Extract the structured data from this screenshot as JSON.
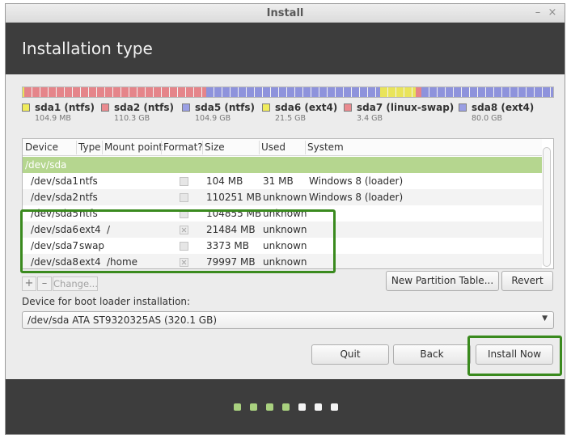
{
  "window": {
    "title": "Install",
    "minimize_glyph": "–",
    "close_glyph": "×"
  },
  "header": {
    "heading": "Installation type"
  },
  "partition_bar": {
    "segments": [
      {
        "name": "sda1",
        "share": 0.33,
        "color": "#e9e45a"
      },
      {
        "name": "sda2",
        "share": 34.46,
        "color": "#e5858a"
      },
      {
        "name": "sda5",
        "share": 32.77,
        "color": "#8e93dc"
      },
      {
        "name": "sda6",
        "share": 6.72,
        "color": "#e9e45a"
      },
      {
        "name": "sda7",
        "share": 1.06,
        "color": "#e5858a"
      },
      {
        "name": "sda8",
        "share": 25.0,
        "color": "#8e93dc"
      }
    ]
  },
  "legend": [
    {
      "name": "sda1 (ntfs)",
      "size": "104.9 MB",
      "color": "#f0ec5c"
    },
    {
      "name": "sda2 (ntfs)",
      "size": "110.3 GB",
      "color": "#ea8a8f"
    },
    {
      "name": "sda5 (ntfs)",
      "size": "104.9 GB",
      "color": "#9a9fe4"
    },
    {
      "name": "sda6 (ext4)",
      "size": "21.5 GB",
      "color": "#f0ec5c"
    },
    {
      "name": "sda7 (linux-swap)",
      "size": "3.4 GB",
      "color": "#ea8a8f"
    },
    {
      "name": "sda8 (ext4)",
      "size": "80.0 GB",
      "color": "#9a9fe4"
    }
  ],
  "table": {
    "headers": [
      "Device",
      "Type",
      "Mount point",
      "Format?",
      "Size",
      "Used",
      "System"
    ],
    "disk_row": "/dev/sda",
    "rows": [
      {
        "device": "/dev/sda1",
        "type": "ntfs",
        "mount": "",
        "format": false,
        "size": "104 MB",
        "used": "31 MB",
        "system": "Windows 8 (loader)"
      },
      {
        "device": "/dev/sda2",
        "type": "ntfs",
        "mount": "",
        "format": false,
        "size": "110251 MB",
        "used": "unknown",
        "system": "Windows 8 (loader)"
      },
      {
        "device": "/dev/sda5",
        "type": "ntfs",
        "mount": "",
        "format": false,
        "size": "104855 MB",
        "used": "unknown",
        "system": ""
      },
      {
        "device": "/dev/sda6",
        "type": "ext4",
        "mount": "/",
        "format": true,
        "size": "21484 MB",
        "used": "unknown",
        "system": ""
      },
      {
        "device": "/dev/sda7",
        "type": "swap",
        "mount": "",
        "format": false,
        "size": "3373 MB",
        "used": "unknown",
        "system": ""
      },
      {
        "device": "/dev/sda8",
        "type": "ext4",
        "mount": "/home",
        "format": true,
        "size": "79997 MB",
        "used": "unknown",
        "system": ""
      }
    ]
  },
  "toolbar": {
    "add_label": "+",
    "remove_label": "–",
    "change_label": "Change...",
    "new_table_label": "New Partition Table...",
    "revert_label": "Revert"
  },
  "bootloader": {
    "label": "Device for boot loader installation:",
    "value": "/dev/sda   ATA ST9320325AS (320.1 GB)"
  },
  "buttons": {
    "quit": "Quit",
    "back": "Back",
    "install": "Install Now"
  },
  "progress": {
    "steps_total": 7,
    "steps_done": 4,
    "done_color": "#a9d17f",
    "todo_color": "#f4f4f4"
  },
  "highlight_color": "#3a8a1e"
}
